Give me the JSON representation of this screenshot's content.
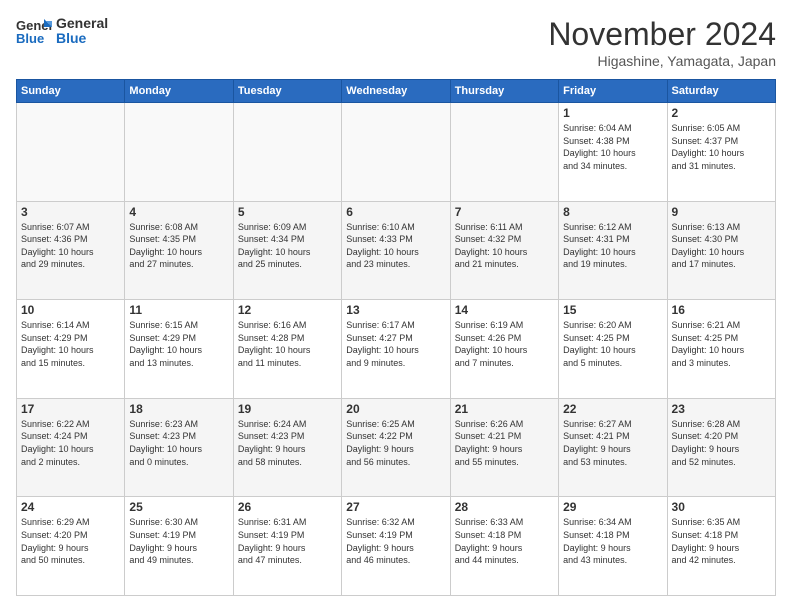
{
  "logo": {
    "line1": "General",
    "line2": "Blue"
  },
  "title": "November 2024",
  "location": "Higashine, Yamagata, Japan",
  "days_of_week": [
    "Sunday",
    "Monday",
    "Tuesday",
    "Wednesday",
    "Thursday",
    "Friday",
    "Saturday"
  ],
  "weeks": [
    [
      {
        "day": "",
        "info": ""
      },
      {
        "day": "",
        "info": ""
      },
      {
        "day": "",
        "info": ""
      },
      {
        "day": "",
        "info": ""
      },
      {
        "day": "",
        "info": ""
      },
      {
        "day": "1",
        "info": "Sunrise: 6:04 AM\nSunset: 4:38 PM\nDaylight: 10 hours\nand 34 minutes."
      },
      {
        "day": "2",
        "info": "Sunrise: 6:05 AM\nSunset: 4:37 PM\nDaylight: 10 hours\nand 31 minutes."
      }
    ],
    [
      {
        "day": "3",
        "info": "Sunrise: 6:07 AM\nSunset: 4:36 PM\nDaylight: 10 hours\nand 29 minutes."
      },
      {
        "day": "4",
        "info": "Sunrise: 6:08 AM\nSunset: 4:35 PM\nDaylight: 10 hours\nand 27 minutes."
      },
      {
        "day": "5",
        "info": "Sunrise: 6:09 AM\nSunset: 4:34 PM\nDaylight: 10 hours\nand 25 minutes."
      },
      {
        "day": "6",
        "info": "Sunrise: 6:10 AM\nSunset: 4:33 PM\nDaylight: 10 hours\nand 23 minutes."
      },
      {
        "day": "7",
        "info": "Sunrise: 6:11 AM\nSunset: 4:32 PM\nDaylight: 10 hours\nand 21 minutes."
      },
      {
        "day": "8",
        "info": "Sunrise: 6:12 AM\nSunset: 4:31 PM\nDaylight: 10 hours\nand 19 minutes."
      },
      {
        "day": "9",
        "info": "Sunrise: 6:13 AM\nSunset: 4:30 PM\nDaylight: 10 hours\nand 17 minutes."
      }
    ],
    [
      {
        "day": "10",
        "info": "Sunrise: 6:14 AM\nSunset: 4:29 PM\nDaylight: 10 hours\nand 15 minutes."
      },
      {
        "day": "11",
        "info": "Sunrise: 6:15 AM\nSunset: 4:29 PM\nDaylight: 10 hours\nand 13 minutes."
      },
      {
        "day": "12",
        "info": "Sunrise: 6:16 AM\nSunset: 4:28 PM\nDaylight: 10 hours\nand 11 minutes."
      },
      {
        "day": "13",
        "info": "Sunrise: 6:17 AM\nSunset: 4:27 PM\nDaylight: 10 hours\nand 9 minutes."
      },
      {
        "day": "14",
        "info": "Sunrise: 6:19 AM\nSunset: 4:26 PM\nDaylight: 10 hours\nand 7 minutes."
      },
      {
        "day": "15",
        "info": "Sunrise: 6:20 AM\nSunset: 4:25 PM\nDaylight: 10 hours\nand 5 minutes."
      },
      {
        "day": "16",
        "info": "Sunrise: 6:21 AM\nSunset: 4:25 PM\nDaylight: 10 hours\nand 3 minutes."
      }
    ],
    [
      {
        "day": "17",
        "info": "Sunrise: 6:22 AM\nSunset: 4:24 PM\nDaylight: 10 hours\nand 2 minutes."
      },
      {
        "day": "18",
        "info": "Sunrise: 6:23 AM\nSunset: 4:23 PM\nDaylight: 10 hours\nand 0 minutes."
      },
      {
        "day": "19",
        "info": "Sunrise: 6:24 AM\nSunset: 4:23 PM\nDaylight: 9 hours\nand 58 minutes."
      },
      {
        "day": "20",
        "info": "Sunrise: 6:25 AM\nSunset: 4:22 PM\nDaylight: 9 hours\nand 56 minutes."
      },
      {
        "day": "21",
        "info": "Sunrise: 6:26 AM\nSunset: 4:21 PM\nDaylight: 9 hours\nand 55 minutes."
      },
      {
        "day": "22",
        "info": "Sunrise: 6:27 AM\nSunset: 4:21 PM\nDaylight: 9 hours\nand 53 minutes."
      },
      {
        "day": "23",
        "info": "Sunrise: 6:28 AM\nSunset: 4:20 PM\nDaylight: 9 hours\nand 52 minutes."
      }
    ],
    [
      {
        "day": "24",
        "info": "Sunrise: 6:29 AM\nSunset: 4:20 PM\nDaylight: 9 hours\nand 50 minutes."
      },
      {
        "day": "25",
        "info": "Sunrise: 6:30 AM\nSunset: 4:19 PM\nDaylight: 9 hours\nand 49 minutes."
      },
      {
        "day": "26",
        "info": "Sunrise: 6:31 AM\nSunset: 4:19 PM\nDaylight: 9 hours\nand 47 minutes."
      },
      {
        "day": "27",
        "info": "Sunrise: 6:32 AM\nSunset: 4:19 PM\nDaylight: 9 hours\nand 46 minutes."
      },
      {
        "day": "28",
        "info": "Sunrise: 6:33 AM\nSunset: 4:18 PM\nDaylight: 9 hours\nand 44 minutes."
      },
      {
        "day": "29",
        "info": "Sunrise: 6:34 AM\nSunset: 4:18 PM\nDaylight: 9 hours\nand 43 minutes."
      },
      {
        "day": "30",
        "info": "Sunrise: 6:35 AM\nSunset: 4:18 PM\nDaylight: 9 hours\nand 42 minutes."
      }
    ]
  ]
}
